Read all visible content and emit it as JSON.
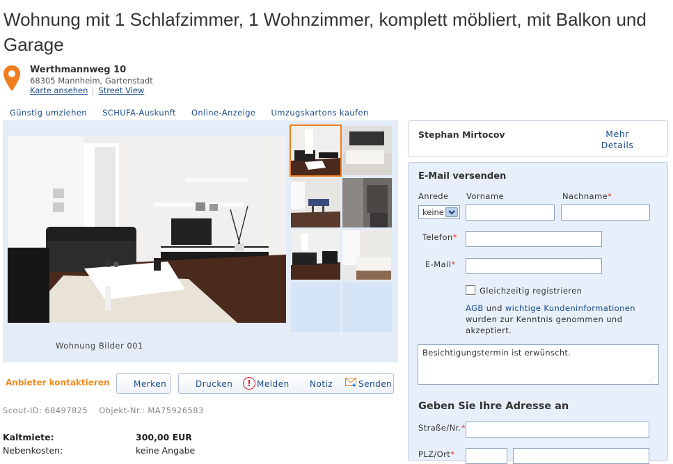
{
  "listing": {
    "title": "Wohnung mit 1 Schlafzimmer, 1 Wohnzimmer, komplett möbliert, mit Balkon und Garage",
    "street": "Werthmannweg 10",
    "city": "68305 Mannheim, Gartenstadt",
    "map_link": "Karte ansehen",
    "street_view_link": "Street View"
  },
  "top_links": [
    "Günstig umziehen",
    "SCHUFA-Auskunft",
    "Online-Anzeige",
    "Umzugskartons kaufen"
  ],
  "gallery": {
    "caption": "Wohnung Bilder 001"
  },
  "actions": {
    "contact": "Anbieter kontaktieren",
    "bookmark": "Merken",
    "print": "Drucken",
    "report": "Melden",
    "note": "Notiz",
    "send": "Senden"
  },
  "ids": {
    "scout_id": "Scout-ID: 68497825",
    "object_nr": "Objekt-Nr.: MA75926583"
  },
  "prices": [
    {
      "label": "Kaltmiete:",
      "value": "300,00 EUR"
    },
    {
      "label": "Nebenkosten:",
      "value": "keine Angabe"
    }
  ],
  "agent": {
    "name": "Stephan Mirtocov",
    "details_link_1": "Mehr",
    "details_link_2": "Details"
  },
  "form": {
    "heading": "E-Mail versenden",
    "anrede_label": "Anrede",
    "anrede_value": "keine",
    "vorname_label": "Vorname",
    "nachname_label": "Nachname",
    "telefon_label": "Telefon",
    "email_label": "E-Mail",
    "required_mark": "*",
    "register_label": "Gleichzeitig registrieren",
    "agb_link": "AGB",
    "agb_and": "und",
    "customer_info_link": "wichtige Kundeninformationen",
    "agb_text_1": "wurden zur Kenntnis genommen und",
    "agb_text_2": "akzeptiert.",
    "message": "Besichtigungstermin ist erwünscht.",
    "address_heading": "Geben Sie Ihre Adresse an",
    "street_label": "Straße/Nr.",
    "plz_label": "PLZ/Ort"
  },
  "colors": {
    "accent_orange": "#f07d1e",
    "link_blue": "#1a4a8a",
    "panel_blue": "#e7effa"
  }
}
